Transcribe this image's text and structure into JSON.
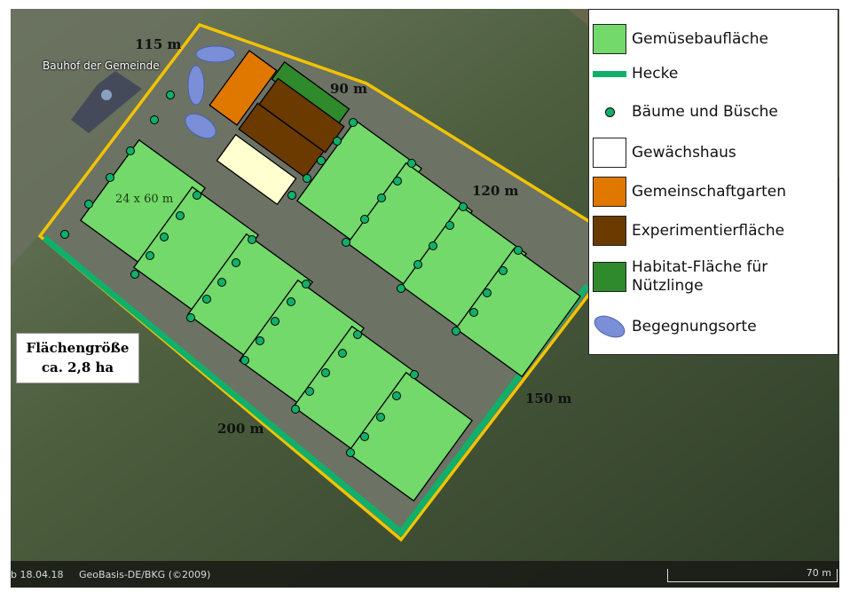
{
  "map": {
    "poi_label": "Bauhof der Gemeinde",
    "dimensions": {
      "top_left": "115 m",
      "top": "90 m",
      "right_upper": "120 m",
      "right_lower": "150 m",
      "bottom": "200 m"
    },
    "field_size": "24 x 60 m",
    "area": {
      "line1": "Flächengröße",
      "line2": "ca. 2,8 ha"
    },
    "footer": {
      "date": "b 18.04.18",
      "copyright": "GeoBasis-DE/BKG (©2009)",
      "scale": "70 m"
    }
  },
  "legend": {
    "items": [
      {
        "label": "Gemüsebaufläche",
        "color": "#72d96a",
        "icon": "square-swatch"
      },
      {
        "label": "Hecke",
        "color": "#11b06a",
        "icon": "line-swatch"
      },
      {
        "label": "Bäume und Büsche",
        "color": "#11b06a",
        "icon": "dot-swatch"
      },
      {
        "label": "Gewächshaus",
        "color": "#ffffff",
        "icon": "square-swatch"
      },
      {
        "label": "Gemeinschaftgarten",
        "color": "#e07800",
        "icon": "square-swatch"
      },
      {
        "label": "Experimentierfläche",
        "color": "#6b3a00",
        "icon": "square-swatch"
      },
      {
        "label": "Habitat-Fläche für Nützlinge",
        "color": "#2e8a2a",
        "icon": "square-swatch"
      },
      {
        "label": "Begegnungsorte",
        "color": "#7a8fd8",
        "icon": "ellipse-swatch"
      }
    ]
  }
}
